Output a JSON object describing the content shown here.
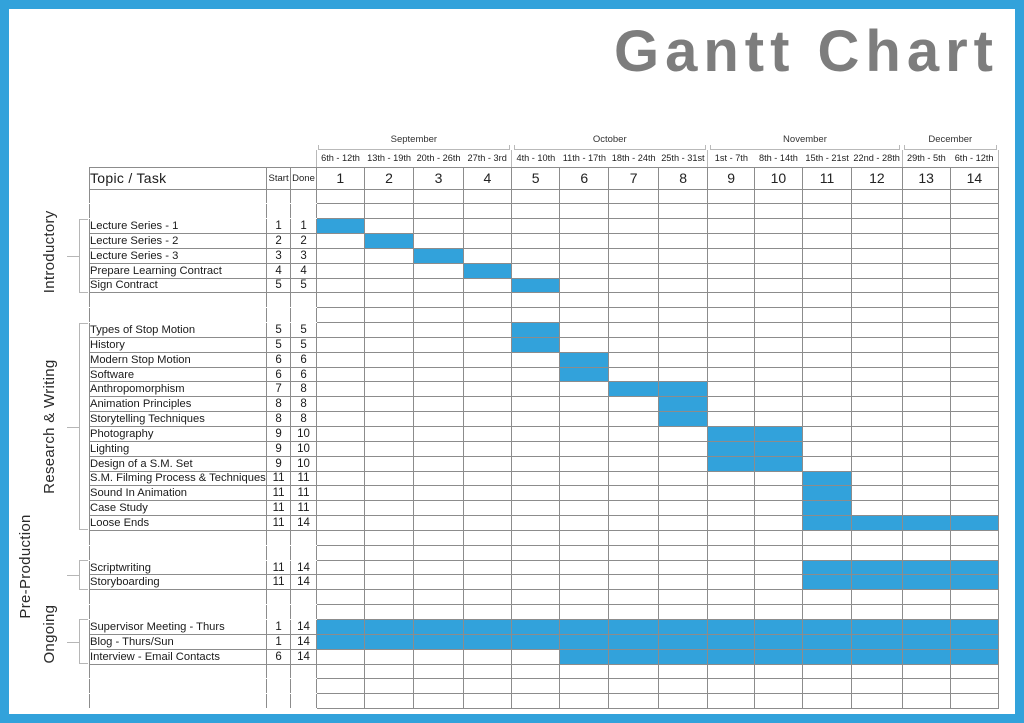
{
  "title": "Gantt Chart",
  "theme": {
    "accent": "#32a2db",
    "title_color": "#7d7d7d",
    "grid_color": "#8c8c8c"
  },
  "header": {
    "task_label": "Topic / Task",
    "start_label": "Start",
    "done_label": "Done"
  },
  "months": [
    {
      "name": "September",
      "span": 4
    },
    {
      "name": "October",
      "span": 4
    },
    {
      "name": "November",
      "span": 4
    },
    {
      "name": "December",
      "span": 2
    }
  ],
  "weeks": [
    {
      "num": "1",
      "dates": "6th - 12th"
    },
    {
      "num": "2",
      "dates": "13th - 19th"
    },
    {
      "num": "3",
      "dates": "20th - 26th"
    },
    {
      "num": "4",
      "dates": "27th - 3rd"
    },
    {
      "num": "5",
      "dates": "4th - 10th"
    },
    {
      "num": "6",
      "dates": "11th - 17th"
    },
    {
      "num": "7",
      "dates": "18th - 24th"
    },
    {
      "num": "8",
      "dates": "25th - 31st"
    },
    {
      "num": "9",
      "dates": "1st - 7th"
    },
    {
      "num": "10",
      "dates": "8th - 14th"
    },
    {
      "num": "11",
      "dates": "15th - 21st"
    },
    {
      "num": "12",
      "dates": "22nd - 28th"
    },
    {
      "num": "13",
      "dates": "29th - 5th"
    },
    {
      "num": "14",
      "dates": "6th - 12th"
    }
  ],
  "groups": [
    {
      "label": "Introductory"
    },
    {
      "label": "Research & Writing"
    },
    {
      "label": "Pre-Production"
    },
    {
      "label": "Ongoing"
    }
  ],
  "chart_data": {
    "type": "bar",
    "title": "Gantt Chart",
    "xlabel": "",
    "ylabel": "Topic / Task",
    "categories": [
      "1",
      "2",
      "3",
      "4",
      "5",
      "6",
      "7",
      "8",
      "9",
      "10",
      "11",
      "12",
      "13",
      "14"
    ],
    "x_group_labels": [
      "September",
      "October",
      "November",
      "December"
    ],
    "xlim": [
      1,
      14
    ],
    "grid": true,
    "legend": "none",
    "tasks": [
      {
        "name": "Lecture Series - 1",
        "start": 1,
        "done": 1,
        "group": "Introductory"
      },
      {
        "name": "Lecture Series - 2",
        "start": 2,
        "done": 2,
        "group": "Introductory"
      },
      {
        "name": "Lecture Series - 3",
        "start": 3,
        "done": 3,
        "group": "Introductory"
      },
      {
        "name": "Prepare Learning Contract",
        "start": 4,
        "done": 4,
        "group": "Introductory"
      },
      {
        "name": "Sign Contract",
        "start": 5,
        "done": 5,
        "group": "Introductory"
      },
      {
        "name": "Types of Stop Motion",
        "start": 5,
        "done": 5,
        "group": "Research & Writing"
      },
      {
        "name": "History",
        "start": 5,
        "done": 5,
        "group": "Research & Writing"
      },
      {
        "name": "Modern Stop Motion",
        "start": 6,
        "done": 6,
        "group": "Research & Writing"
      },
      {
        "name": "Software",
        "start": 6,
        "done": 6,
        "group": "Research & Writing"
      },
      {
        "name": "Anthropomorphism",
        "start": 7,
        "done": 8,
        "group": "Research & Writing"
      },
      {
        "name": "Animation Principles",
        "start": 8,
        "done": 8,
        "group": "Research & Writing"
      },
      {
        "name": "Storytelling Techniques",
        "start": 8,
        "done": 8,
        "group": "Research & Writing"
      },
      {
        "name": "Photography",
        "start": 9,
        "done": 10,
        "group": "Research & Writing"
      },
      {
        "name": "Lighting",
        "start": 9,
        "done": 10,
        "group": "Research & Writing"
      },
      {
        "name": "Design of a S.M. Set",
        "start": 9,
        "done": 10,
        "group": "Research & Writing"
      },
      {
        "name": "S.M. Filming Process & Techniques",
        "start": 11,
        "done": 11,
        "group": "Research & Writing"
      },
      {
        "name": "Sound In Animation",
        "start": 11,
        "done": 11,
        "group": "Research & Writing"
      },
      {
        "name": "Case Study",
        "start": 11,
        "done": 11,
        "group": "Research & Writing"
      },
      {
        "name": "Loose Ends",
        "start": 11,
        "done": 14,
        "group": "Research & Writing"
      },
      {
        "name": "Scriptwriting",
        "start": 11,
        "done": 14,
        "group": "Pre-Production"
      },
      {
        "name": "Storyboarding",
        "start": 11,
        "done": 14,
        "group": "Pre-Production"
      },
      {
        "name": "Supervisor Meeting - Thurs",
        "start": 1,
        "done": 14,
        "group": "Ongoing"
      },
      {
        "name": "Blog - Thurs/Sun",
        "start": 1,
        "done": 14,
        "group": "Ongoing"
      },
      {
        "name": "Interview - Email Contacts",
        "start": 6,
        "done": 14,
        "group": "Ongoing"
      }
    ]
  }
}
